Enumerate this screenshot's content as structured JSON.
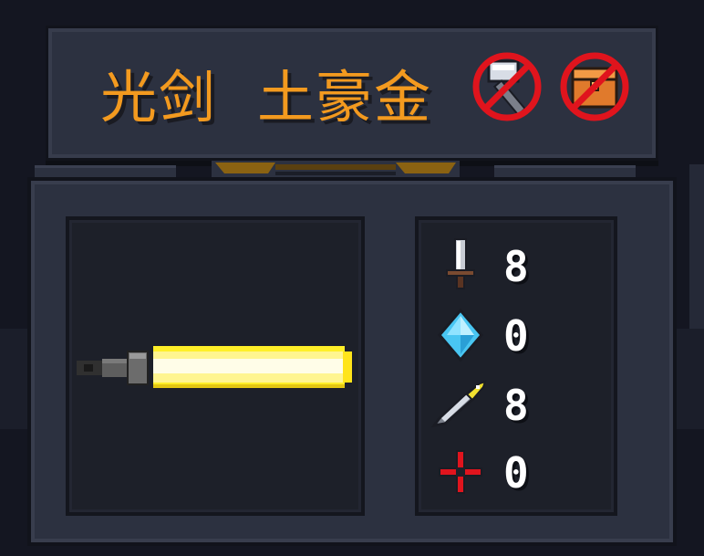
{
  "weapon": {
    "name": "光剑",
    "tier": "土豪金"
  },
  "restrictions": [
    {
      "icon": "hammer-icon",
      "blocked": true
    },
    {
      "icon": "chest-icon",
      "blocked": true
    }
  ],
  "stats": {
    "damage": "8",
    "energy": "0",
    "critical": "8",
    "spread": "0"
  },
  "colors": {
    "title": "#f39a1f",
    "blade": "#ffef28",
    "prohibit": "#e0141d"
  }
}
